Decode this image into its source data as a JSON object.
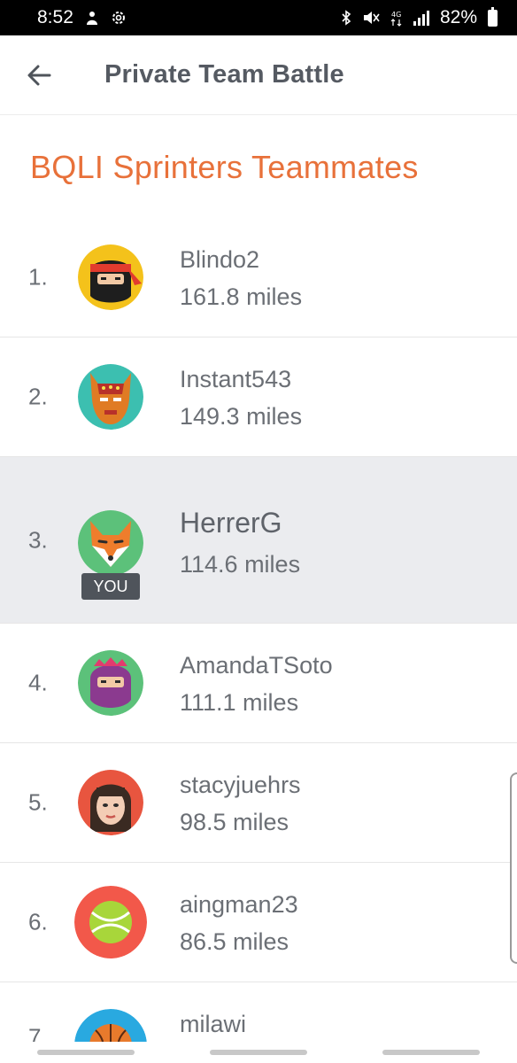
{
  "status_bar": {
    "time": "8:52",
    "battery": "82%"
  },
  "header": {
    "title": "Private Team Battle"
  },
  "section": {
    "title": "BQLI Sprinters Teammates"
  },
  "you_label": "YOU",
  "entries": [
    {
      "rank": "1.",
      "name": "Blindo2",
      "distance": "161.8 miles",
      "avatar": "ninja-red-bandana-avatar"
    },
    {
      "rank": "2.",
      "name": "Instant543",
      "distance": "149.3 miles",
      "avatar": "luchador-mask-avatar"
    },
    {
      "rank": "3.",
      "name": "HerrerG",
      "distance": "114.6 miles",
      "avatar": "fox-avatar"
    },
    {
      "rank": "4.",
      "name": "AmandaTSoto",
      "distance": "111.1 miles",
      "avatar": "pink-ninja-avatar"
    },
    {
      "rank": "5.",
      "name": "stacyjuehrs",
      "distance": "98.5 miles",
      "avatar": "woman-portrait-avatar"
    },
    {
      "rank": "6.",
      "name": "aingman23",
      "distance": "86.5 miles",
      "avatar": "tennis-ball-avatar"
    },
    {
      "rank": "7.",
      "name": "milawi",
      "distance": "",
      "avatar": "basketball-avatar"
    }
  ],
  "colors": {
    "accent": "#e8713a",
    "highlight_row": "#ebecef",
    "text": "#6b6f75"
  }
}
